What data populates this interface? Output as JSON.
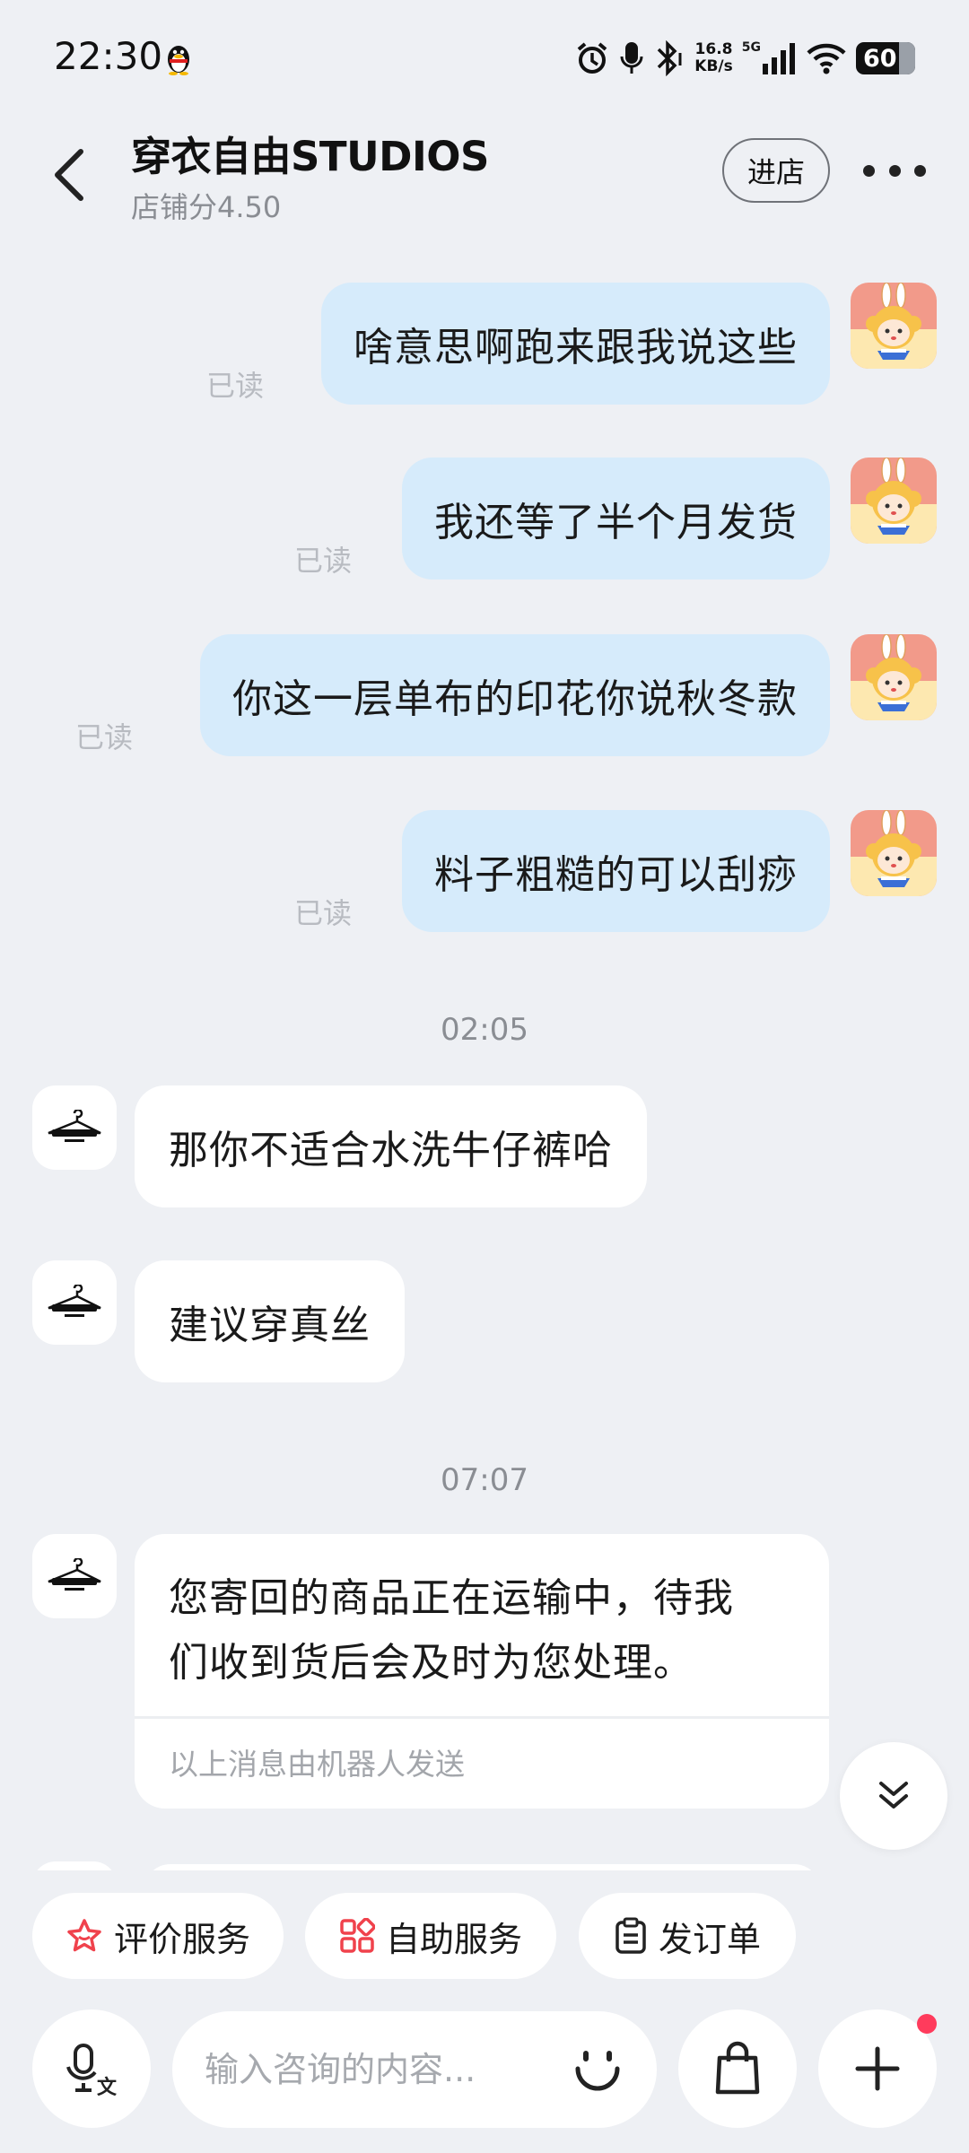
{
  "status_bar": {
    "time": "22:30",
    "net_speed_value": "16.8",
    "net_speed_unit": "KB/s",
    "network": "5G",
    "battery": "60",
    "icons": [
      "qq-penguin-icon",
      "alarm-icon",
      "mic-icon",
      "bluetooth-icon",
      "signal-icon",
      "wifi-icon",
      "battery-icon"
    ]
  },
  "header": {
    "shop_name": "穿衣自由STUDIOS",
    "shop_score": "店铺分4.50",
    "enter_label": "进店"
  },
  "messages": [
    {
      "from": "me",
      "text": "啥意思啊跑来跟我说这些",
      "status": "已读"
    },
    {
      "from": "me",
      "text": "我还等了半个月发货",
      "status": "已读"
    },
    {
      "from": "me",
      "text": "你这一层单布的印花你说秋冬款",
      "status": "已读"
    },
    {
      "from": "me",
      "text": "料子粗糙的可以刮痧",
      "status": "已读"
    },
    {
      "timestamp": "02:05"
    },
    {
      "from": "shop",
      "text": "那你不适合水洗牛仔裤哈"
    },
    {
      "from": "shop",
      "text": "建议穿真丝"
    },
    {
      "timestamp": "07:07"
    },
    {
      "from": "shop",
      "text_line1": "您寄回的商品正在运输中，待我",
      "text_line2": "们收到货后会及时为您处理。",
      "note": "以上消息由机器人发送"
    }
  ],
  "quick_actions": [
    {
      "label": "评价服务",
      "icon": "star-icon",
      "color": "#f0424c"
    },
    {
      "label": "自助服务",
      "icon": "grid-icon",
      "color": "#f0424c"
    },
    {
      "label": "发订单",
      "icon": "clipboard-icon",
      "color": "#222222"
    }
  ],
  "input": {
    "placeholder": "输入咨询的内容...",
    "value": ""
  },
  "colors": {
    "background": "#eef0f4",
    "outgoing_bubble": "#d6ebfb",
    "incoming_bubble": "#ffffff",
    "badge_dot": "#ff3b5c"
  }
}
